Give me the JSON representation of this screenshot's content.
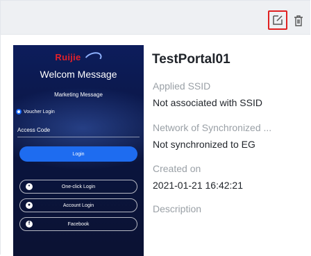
{
  "card": {
    "actions": {
      "edit_icon": "edit-icon",
      "delete_icon": "trash-icon",
      "highlight_color": "#e02020"
    },
    "portal_name": "TestPortal01",
    "applied_ssid_label": "Applied SSID",
    "applied_ssid_value": "Not associated with SSID",
    "sync_label": "Network of Synchronized ...",
    "sync_value": "Not synchronized to EG",
    "created_label": "Created on",
    "created_value": "2021-01-21 16:42:21",
    "description_label": "Description"
  },
  "preview": {
    "logo_text": "Ruijie",
    "welcome": "Welcom Message",
    "marketing": "Marketing Message",
    "voucher_login": "Voucher Login",
    "access_code": "Access Code",
    "login_button": "Login",
    "one_click": "One-click Login",
    "account_login": "Account Login",
    "facebook": "Facebook"
  }
}
